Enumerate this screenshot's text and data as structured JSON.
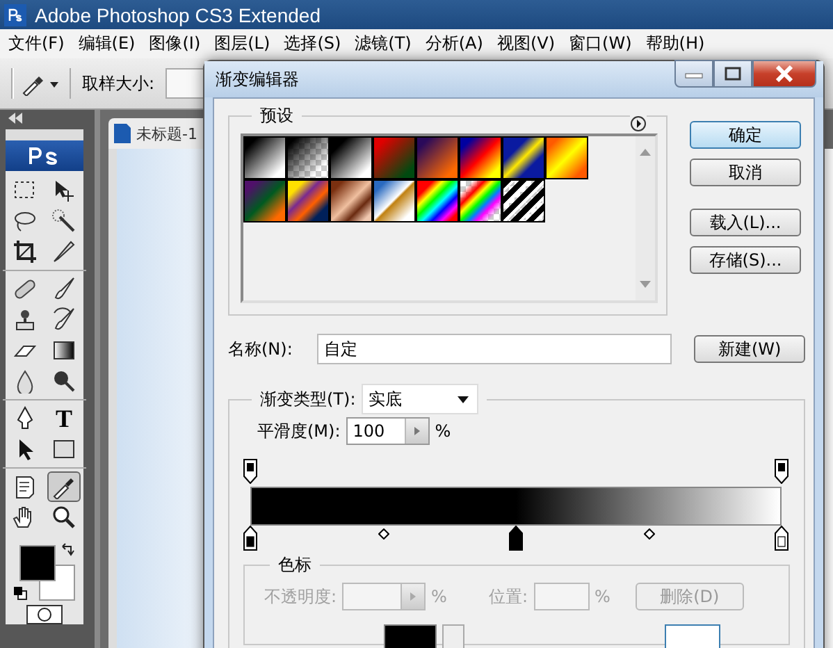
{
  "window": {
    "title": "Adobe Photoshop CS3 Extended"
  },
  "menu": [
    "文件(F)",
    "编辑(E)",
    "图像(I)",
    "图层(L)",
    "选择(S)",
    "滤镜(T)",
    "分析(A)",
    "视图(V)",
    "窗口(W)",
    "帮助(H)"
  ],
  "options_bar": {
    "sample_size_label": "取样大小:"
  },
  "toolbox": {
    "tools": [
      {
        "selected": false
      },
      {
        "selected": false
      },
      {
        "selected": false
      },
      {
        "selected": false
      },
      {
        "selected": false
      },
      {
        "selected": false
      },
      {
        "selected": false
      },
      {
        "selected": false
      },
      {
        "selected": false
      },
      {
        "selected": false
      },
      {
        "selected": false
      },
      {
        "selected": false
      },
      {
        "selected": false
      },
      {
        "selected": false
      },
      {
        "selected": false
      },
      {
        "selected": false,
        "label": "T"
      },
      {
        "selected": false
      },
      {
        "selected": false
      },
      {
        "selected": false
      },
      {
        "selected": true
      },
      {
        "selected": false
      },
      {
        "selected": false
      }
    ]
  },
  "document": {
    "tab": "未标题-1"
  },
  "dialog": {
    "title": "渐变编辑器",
    "presets_label": "预设",
    "buttons": [
      "确定",
      "取消",
      "载入(L)...",
      "存储(S)..."
    ],
    "name_label": "名称(N):",
    "name_value": "自定",
    "new_button": "新建(W)",
    "gradient_type_label": "渐变类型(T):",
    "gradient_type": "实底",
    "smoothness_label": "平滑度(M):",
    "smoothness": "100",
    "smoothness_unit": "%",
    "opacity_stops": [
      {
        "level": 0,
        "selected": false
      },
      {
        "level": 1,
        "selected": false
      }
    ],
    "color_stops": [
      {
        "level": 0,
        "color": "#000000",
        "selected": false
      },
      {
        "level": 0.5,
        "color": "#000000",
        "selected": true
      },
      {
        "level": 1,
        "color": "#ffffff",
        "selected": false
      }
    ],
    "midpoints": [
      {
        "level": 0.25
      },
      {
        "level": 0.75
      }
    ],
    "stops_section": {
      "title": "色标",
      "opacity_label": "不透明度:",
      "opacity_unit": "%",
      "position_label": "位置:",
      "position_unit": "%",
      "delete_button": "删除(D)",
      "disabled": true
    }
  }
}
